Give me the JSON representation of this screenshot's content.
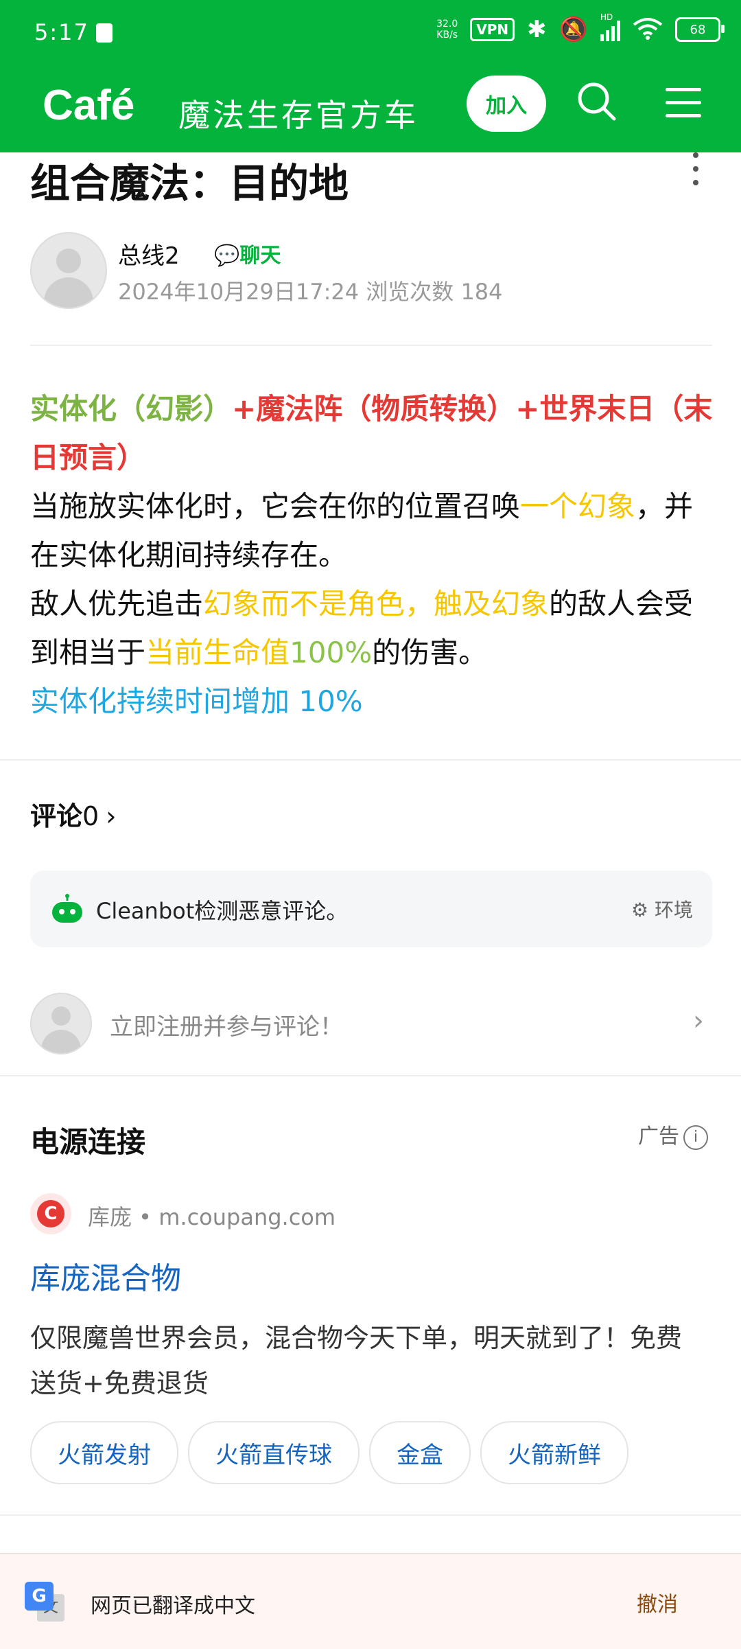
{
  "status": {
    "time": "5:17",
    "network_speed_value": "32.0",
    "network_speed_unit": "KB/s",
    "vpn": "VPN",
    "network_type": "HD",
    "battery": "68"
  },
  "header": {
    "logo": "Café",
    "cafe_name": "魔法生存官方车",
    "join_label": "加入"
  },
  "article": {
    "title": "组合魔法：目的地",
    "author": "总线2",
    "chat_label": "聊天",
    "meta": "2024年10月29日17:24  浏览次数 184",
    "combo_green": "实体化（幻影）",
    "combo_red": "+魔法阵（物质转换）+世界末日（末日预言）",
    "p1_a": "当施放实体化时，它会在你的位置召唤",
    "p1_b": "一个幻象",
    "p1_c": "，并在实体化期间持续存在。",
    "p2_a": "敌人优先追击",
    "p2_b": "幻象而不是角色，触及幻象",
    "p2_c": "的敌人会受到相当于",
    "p2_d": "当前生命值",
    "p2_e": "100%",
    "p2_f": "的伤害。",
    "p3": "实体化持续时间增加 10%"
  },
  "comments": {
    "label": "评论",
    "count": "0",
    "cleanbot_text": "Cleanbot检测恶意评论。",
    "environment_label": "环境",
    "register_prompt": "立即注册并参与评论！"
  },
  "ad": {
    "section_title": "电源连接",
    "ad_label": "广告",
    "source": "库庞 • m.coupang.com",
    "link_title": "库庞混合物",
    "description": "仅限魔兽世界会员，混合物今天下单，明天就到了！免费送货+免费退货",
    "chips": [
      "火箭发射",
      "火箭直传球",
      "金盒",
      "火箭新鲜"
    ]
  },
  "translate_bar": {
    "message": "网页已翻译成中文",
    "undo_label": "撤消"
  },
  "colors": {
    "brand_green": "#03b33c",
    "combo_green": "#7cb342",
    "combo_red": "#e53935",
    "highlight_yellow": "#f6c700",
    "info_blue": "#1ea7e1",
    "link_blue": "#1565c0"
  }
}
